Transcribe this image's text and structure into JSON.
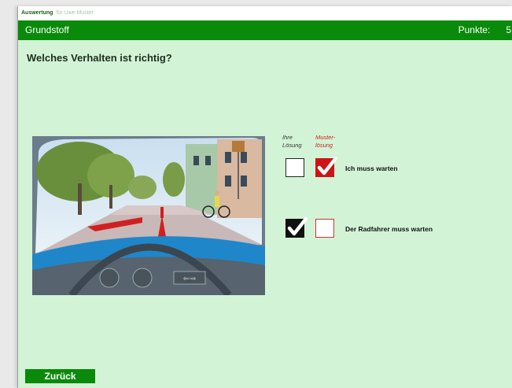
{
  "window": {
    "title_bold": "Auswertung",
    "title_rest": "für Uwe Muster"
  },
  "header": {
    "section": "Grundstoff",
    "score_label": "Punkte:",
    "score_value": "5"
  },
  "question": "Welches Verhalten ist richtig?",
  "columns": {
    "yours": [
      "Ihre",
      "Lösung"
    ],
    "model": [
      "Muster-",
      "lösung"
    ]
  },
  "answers": [
    {
      "label": "Ich muss warten",
      "your_choice": false,
      "correct": true
    },
    {
      "label": "Der Radfahrer muss warten",
      "your_choice": true,
      "correct": false
    }
  ],
  "colors": {
    "header_green": "#0a8a0a",
    "background": "#d2f3d6",
    "correct_red": "#cc1515"
  },
  "back_button": "Zurück"
}
